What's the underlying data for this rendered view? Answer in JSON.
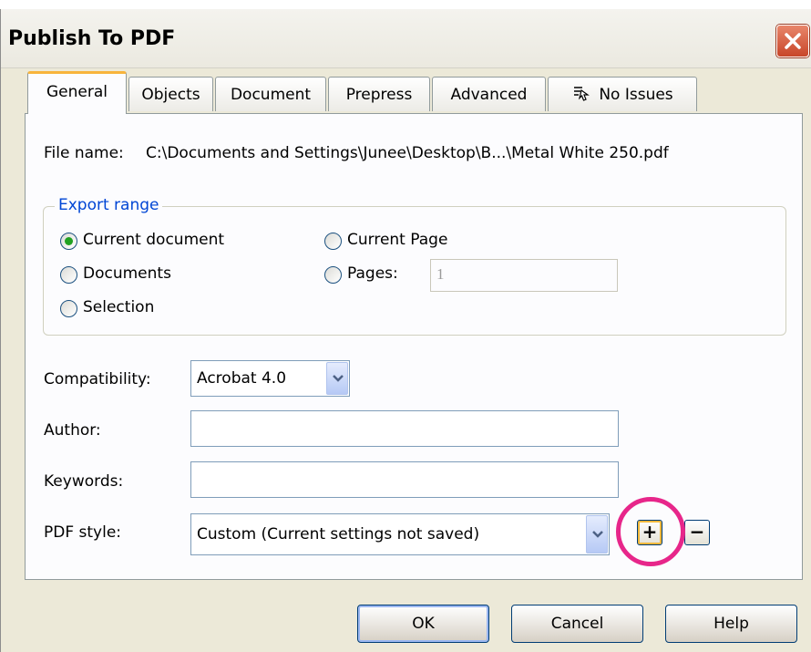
{
  "window": {
    "title": "Publish To PDF"
  },
  "tabs": [
    {
      "label": "General"
    },
    {
      "label": "Objects"
    },
    {
      "label": "Document"
    },
    {
      "label": "Prepress"
    },
    {
      "label": "Advanced"
    },
    {
      "label": "No Issues",
      "icon": "issues-icon"
    }
  ],
  "general": {
    "file_name_label": "File name:",
    "file_name_value": "C:\\Documents and Settings\\Junee\\Desktop\\B...\\Metal White 250.pdf",
    "export_range": {
      "legend": "Export range",
      "options": [
        {
          "label": "Current document",
          "checked": true
        },
        {
          "label": "Current Page",
          "checked": false
        },
        {
          "label": "Documents",
          "checked": false
        },
        {
          "label": "Pages:",
          "checked": false
        },
        {
          "label": "Selection",
          "checked": false
        }
      ],
      "pages_value": "1"
    },
    "compatibility": {
      "label": "Compatibility:",
      "value": "Acrobat 4.0"
    },
    "author": {
      "label": "Author:",
      "value": ""
    },
    "keywords": {
      "label": "Keywords:",
      "value": ""
    },
    "pdf_style": {
      "label": "PDF style:",
      "value": "Custom (Current settings not saved)",
      "add_label": "+",
      "remove_label": "−"
    }
  },
  "buttons": {
    "ok": "OK",
    "cancel": "Cancel",
    "help": "Help"
  },
  "colors": {
    "accent_legend": "#0046d5",
    "tab_highlight": "#f8b43c",
    "annotation_ring": "#e7268a"
  }
}
